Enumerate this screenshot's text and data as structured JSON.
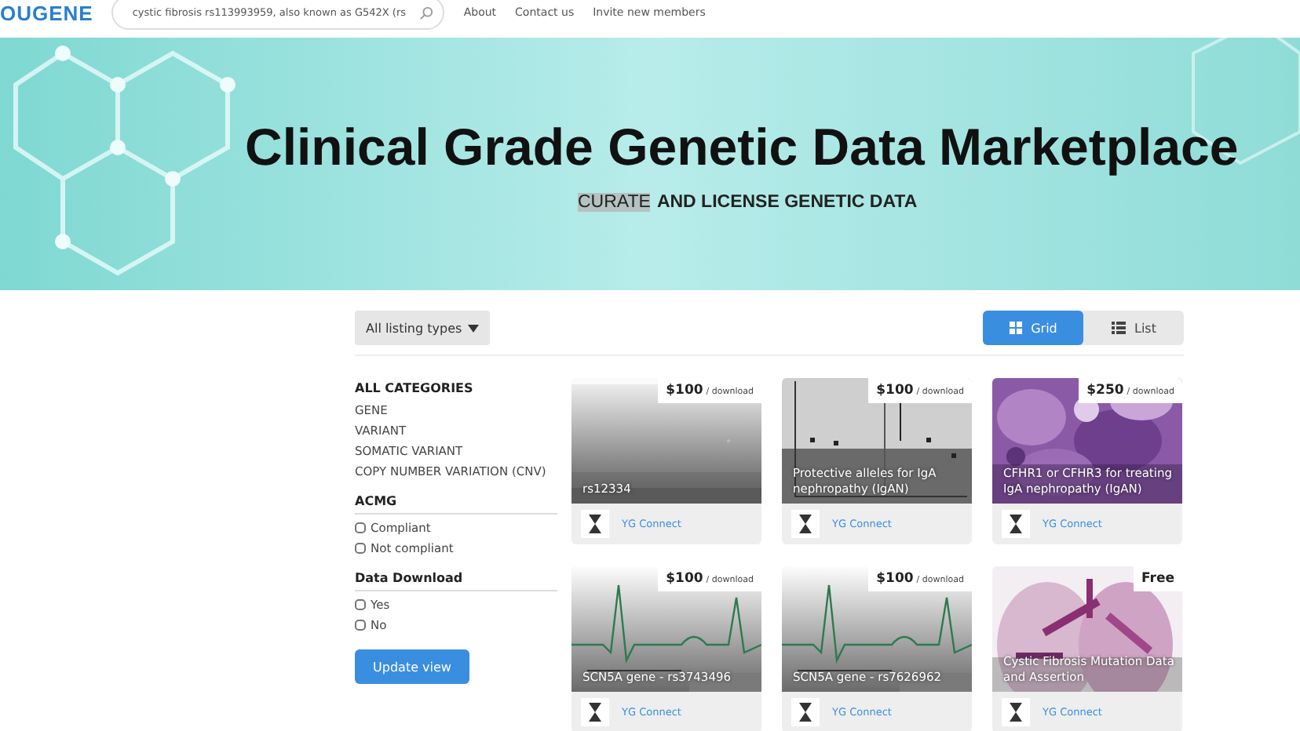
{
  "header": {
    "logo": "OUGENE",
    "search": {
      "value": "cystic fibrosis rs113993959, also known as G542X (rs"
    },
    "links": [
      "About",
      "Contact us",
      "Invite new members"
    ]
  },
  "banner": {
    "title": "Clinical Grade Genetic Data Marketplace",
    "tagline": [
      {
        "text": "CURATE",
        "highlighted": true
      },
      {
        "text": "AND LICENSE GENETIC DATA",
        "highlighted": false
      }
    ]
  },
  "filter_dropdown": {
    "label": "All listing types"
  },
  "view_toggle": [
    {
      "label": "Grid",
      "kind": "grid",
      "selected": true
    },
    {
      "label": "List",
      "kind": "list",
      "selected": false
    }
  ],
  "sidebar": {
    "categories_title": "ALL CATEGORIES",
    "categories": [
      "GENE",
      "VARIANT",
      "SOMATIC VARIANT",
      "COPY NUMBER VARIATION (CNV)"
    ],
    "groups": [
      {
        "title": "ACMG",
        "options": [
          {
            "label": "Compliant",
            "checked": false
          },
          {
            "label": "Not compliant",
            "checked": false
          }
        ]
      },
      {
        "title": "Data Download",
        "options": [
          {
            "label": "Yes",
            "checked": false
          },
          {
            "label": "No",
            "checked": false
          }
        ]
      }
    ],
    "button": "Update view"
  },
  "cards": [
    {
      "price": "$100",
      "unit": "/ download",
      "title": "rs12334",
      "publisher": "YG Connect"
    },
    {
      "price": "$100",
      "unit": "/ download",
      "title": "Protective alleles for IgA nephropathy (IgAN)",
      "publisher": "YG Connect"
    },
    {
      "price": "$250",
      "unit": "/ download",
      "title": "CFHR1 or CFHR3 for treating IgA nephropathy (IgAN)",
      "publisher": "YG Connect"
    },
    {
      "price": "$100",
      "unit": "/ download",
      "title": "SCN5A gene - rs3743496",
      "publisher": "YG Connect"
    },
    {
      "price": "$100",
      "unit": "/ download",
      "title": "SCN5A gene - rs7626962",
      "publisher": "YG Connect"
    },
    {
      "price": "Free",
      "title": "Cystic Fibrosis Mutation Data and Assertion",
      "publisher": "YG Connect"
    }
  ]
}
